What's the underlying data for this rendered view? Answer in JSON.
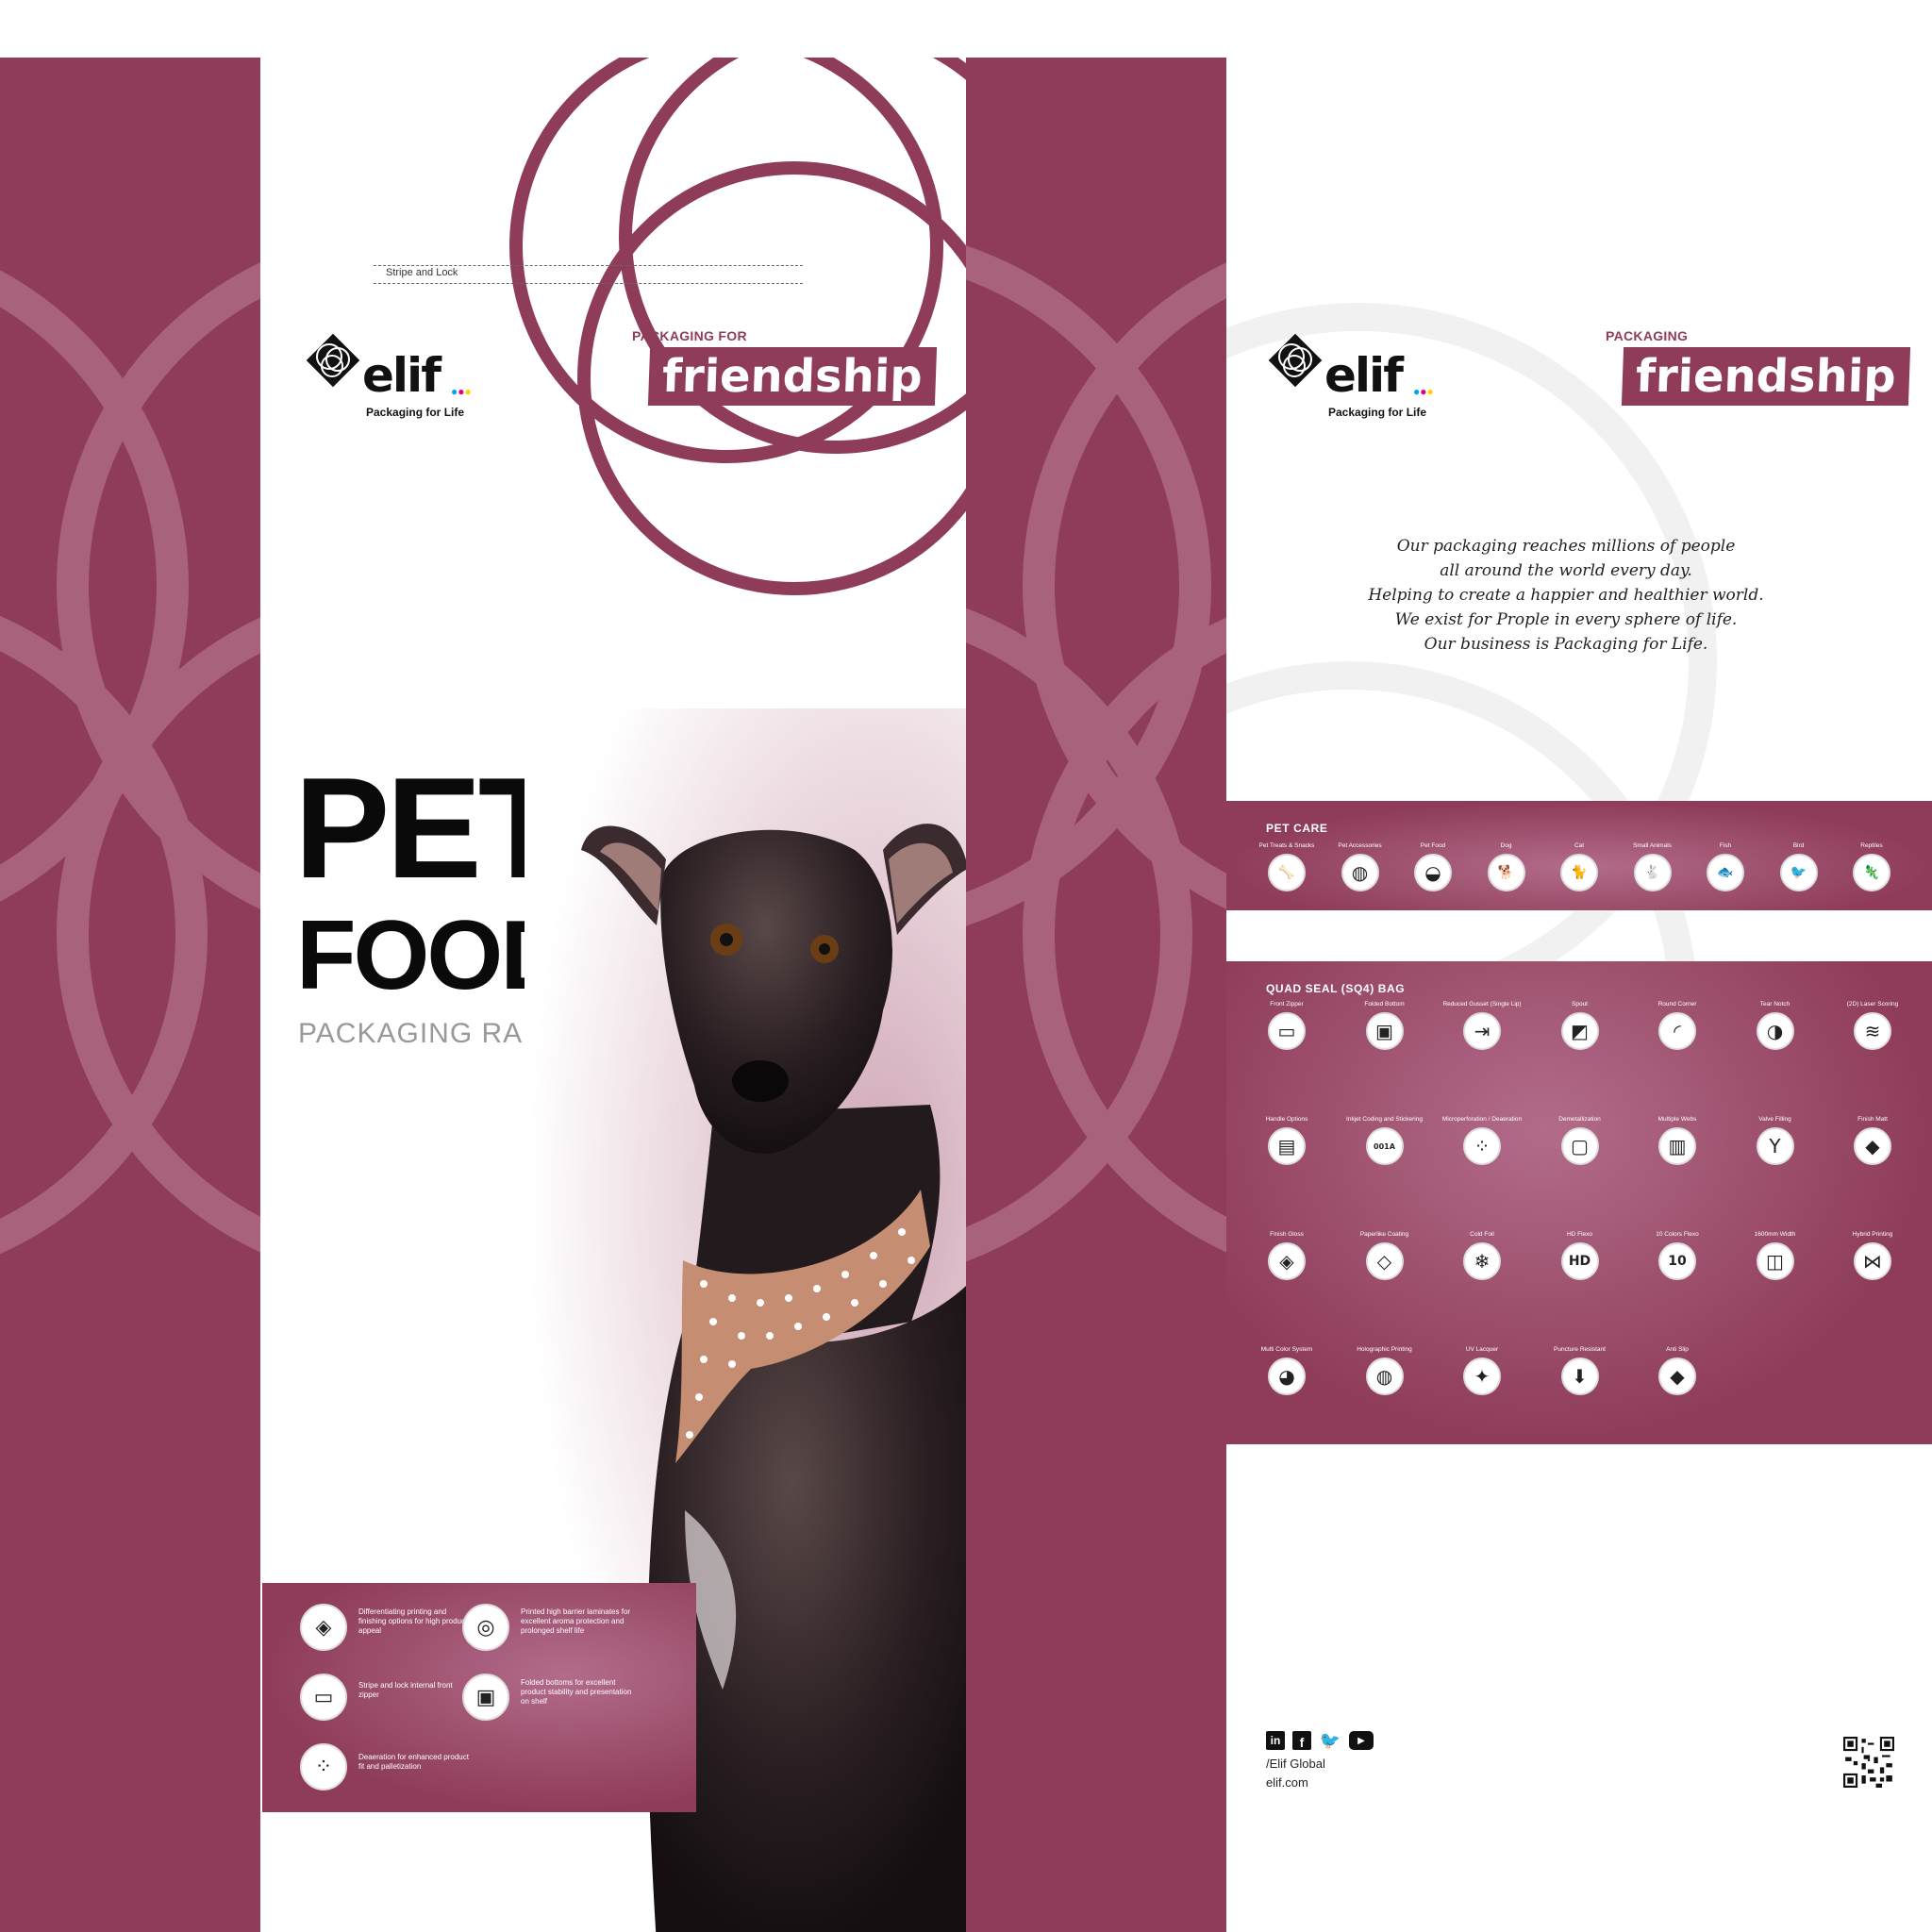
{
  "colors": {
    "maroon": "#8e3c5a",
    "maroon_light": "#b06a86",
    "white": "#ffffff",
    "black": "#111111"
  },
  "front": {
    "stripe_label": "Stripe and Lock",
    "logo": {
      "name": "elif",
      "tagline": "Packaging for Life"
    },
    "packaging_for": "PACKAGING FOR",
    "friendship": "friendship",
    "title_line1": "PET",
    "title_line2": "FOOD",
    "subtitle": "PACKAGING RANGE",
    "features": [
      {
        "icon": "print-finish-icon",
        "glyph": "◈",
        "text": "Differentiating printing and finishing options for high product appeal"
      },
      {
        "icon": "barrier-laminate-icon",
        "glyph": "◎",
        "text": "Printed high barrier laminates for excellent aroma protection and prolonged shelf life"
      },
      {
        "icon": "zipper-icon",
        "glyph": "▭",
        "text": "Stripe and lock internal front zipper"
      },
      {
        "icon": "folded-bottom-icon",
        "glyph": "▣",
        "text": "Folded bottoms for excellent product stability and presentation on shelf"
      },
      {
        "icon": "deaeration-icon",
        "glyph": "⁘",
        "text": "Deaeration for enhanced product fit and palletization"
      }
    ]
  },
  "back": {
    "logo": {
      "name": "elif",
      "tagline": "Packaging for Life"
    },
    "packaging": "PACKAGING",
    "friendship": "friendship",
    "mission_lines": [
      "Our packaging reaches millions of people",
      "all around the world every day.",
      "Helping to create a happier and healthier world.",
      "We exist for Prople in every sphere of life.",
      "Our business is Packaging for Life."
    ],
    "pet_care": {
      "title": "PET CARE",
      "items": [
        {
          "label": "Pet Treats & Snacks",
          "icon": "bone-icon",
          "glyph": "🦴"
        },
        {
          "label": "Pet Accessories",
          "icon": "collar-icon",
          "glyph": "◍"
        },
        {
          "label": "Pet Food",
          "icon": "food-bowl-icon",
          "glyph": "◒"
        },
        {
          "label": "Dog",
          "icon": "dog-icon",
          "glyph": "🐕"
        },
        {
          "label": "Cat",
          "icon": "cat-icon",
          "glyph": "🐈"
        },
        {
          "label": "Small Animals",
          "icon": "rabbit-icon",
          "glyph": "🐇"
        },
        {
          "label": "Fish",
          "icon": "fish-icon",
          "glyph": "🐟"
        },
        {
          "label": "Bird",
          "icon": "bird-icon",
          "glyph": "🐦"
        },
        {
          "label": "Reptiles",
          "icon": "lizard-icon",
          "glyph": "🦎"
        }
      ]
    },
    "quad_seal": {
      "title": "QUAD SEAL (SQ4) BAG",
      "items": [
        {
          "label": "Front Zipper",
          "icon": "zipper-icon",
          "glyph": "▭"
        },
        {
          "label": "Folded Bottom",
          "icon": "folded-bottom-icon",
          "glyph": "▣"
        },
        {
          "label": "Reduced Gusset (Single Lip)",
          "icon": "gusset-icon",
          "glyph": "⇥"
        },
        {
          "label": "Spout",
          "icon": "spout-icon",
          "glyph": "◩"
        },
        {
          "label": "Round Corner",
          "icon": "round-corner-icon",
          "glyph": "◜"
        },
        {
          "label": "Tear Notch",
          "icon": "tear-notch-icon",
          "glyph": "◑"
        },
        {
          "label": "(2D) Laser Scoring",
          "icon": "laser-scoring-icon",
          "glyph": "≋"
        },
        {
          "label": "Handle Options",
          "icon": "handle-icon",
          "glyph": "▤"
        },
        {
          "label": "Inkjet Coding and Stickering",
          "icon": "inkjet-coding-icon",
          "glyph": "001A"
        },
        {
          "label": "Microperforation / Deaeration",
          "icon": "microperforation-icon",
          "glyph": "⁘"
        },
        {
          "label": "Demetallization",
          "icon": "demetallization-icon",
          "glyph": "▢"
        },
        {
          "label": "Multiple Webs",
          "icon": "multiple-webs-icon",
          "glyph": "▥"
        },
        {
          "label": "Valve Filling",
          "icon": "valve-filling-icon",
          "glyph": "Y"
        },
        {
          "label": "Finish Matt",
          "icon": "finish-matt-icon",
          "glyph": "◆"
        },
        {
          "label": "Finish Gloss",
          "icon": "finish-gloss-icon",
          "glyph": "◈"
        },
        {
          "label": "Paperlike Coating",
          "icon": "paperlike-coating-icon",
          "glyph": "◇"
        },
        {
          "label": "Cold Foil",
          "icon": "cold-foil-icon",
          "glyph": "❄"
        },
        {
          "label": "HD Flexo",
          "icon": "hd-flexo-icon",
          "glyph": "HD"
        },
        {
          "label": "10 Colors Flexo",
          "icon": "ten-colors-icon",
          "glyph": "10"
        },
        {
          "label": "1600mm Width",
          "icon": "width-roll-icon",
          "glyph": "◫"
        },
        {
          "label": "Hybrid Printing",
          "icon": "hybrid-printing-icon",
          "glyph": "⋈"
        },
        {
          "label": "Multi Color System",
          "icon": "palette-icon",
          "glyph": "◕"
        },
        {
          "label": "Holographic Printing",
          "icon": "holographic-icon",
          "glyph": "◍"
        },
        {
          "label": "UV Lacquer",
          "icon": "uv-lacquer-icon",
          "glyph": "✦"
        },
        {
          "label": "Puncture Resistant",
          "icon": "puncture-icon",
          "glyph": "⬇"
        },
        {
          "label": "Anti Slip",
          "icon": "anti-slip-icon",
          "glyph": "◆"
        }
      ]
    },
    "social_handle": "/Elif Global",
    "website": "elif.com"
  }
}
